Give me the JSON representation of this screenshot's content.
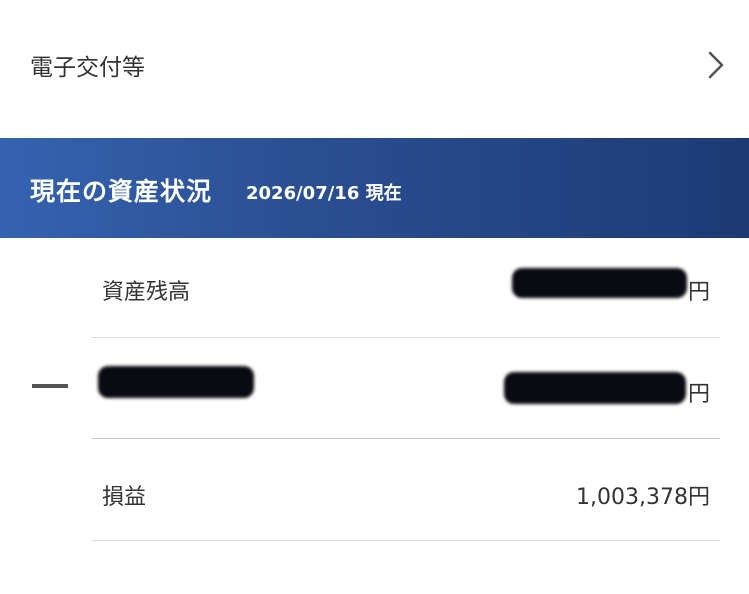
{
  "nav": {
    "label": "電子交付等",
    "chevron_icon": "chevron-right-icon"
  },
  "banner": {
    "title": "現在の資産状況",
    "date": "2026/07/16 現在",
    "gradient_start": "#3563b0",
    "gradient_end": "#1d3a74"
  },
  "rows": [
    {
      "label": "資産残高",
      "value_suffix": "円",
      "redacted": true
    },
    {
      "label": "",
      "value_suffix": "円",
      "redacted": true
    },
    {
      "label": "損益",
      "value": "1,003,378円",
      "redacted": false
    }
  ],
  "collapse_icon": "minus-icon"
}
